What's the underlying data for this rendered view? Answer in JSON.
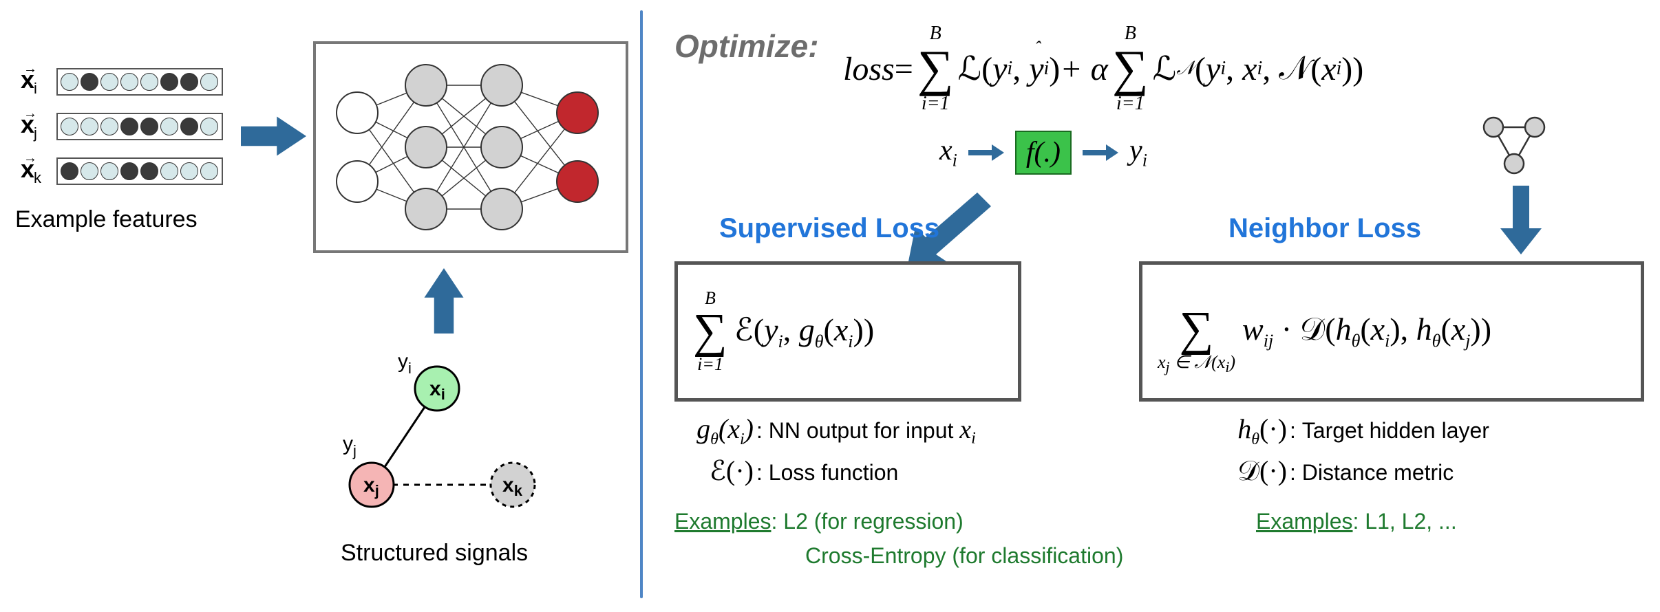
{
  "left": {
    "vectors": {
      "x_i": "x",
      "x_j": "x",
      "x_k": "x",
      "sub_i": "i",
      "sub_j": "j",
      "sub_k": "k"
    },
    "example_features_caption": "Example features",
    "structured_signals_caption": "Structured signals",
    "graph_labels": {
      "yi": "y",
      "yi_sub": "i",
      "xi": "x",
      "xi_sub": "i",
      "yj": "y",
      "yj_sub": "j",
      "xj": "x",
      "xj_sub": "j",
      "xk": "x",
      "xk_sub": "k"
    }
  },
  "right": {
    "optimize": "Optimize:",
    "loss_eq": {
      "loss": "loss",
      "eq": " = ",
      "sum_top": "B",
      "sum_bot": "i=1",
      "L": "ℒ",
      "y": "y",
      "sub_i": "i",
      "yhat": "ŷ",
      "plus_alpha": " + α",
      "Ln_sub": "𝒩",
      "x": "x",
      "N": "𝒩"
    },
    "flow": {
      "xi": "x",
      "sub_i": "i",
      "f": "f(.)",
      "yi": "y"
    },
    "titles": {
      "sup": "Supervised Loss",
      "nei": "Neighbor Loss"
    },
    "sup_box": {
      "sum_top": "B",
      "sum_bot": "i=1",
      "E": "ℰ",
      "y": "y",
      "g": "g",
      "theta": "θ",
      "x": "x",
      "sub_i": "i"
    },
    "nei_box": {
      "sum_bot_pre": "x",
      "sum_bot_sub": "j",
      "sum_bot_in": " ∈ 𝒩(x",
      "sum_bot_sub2": "i",
      "sum_bot_post": ")",
      "w": "w",
      "w_sub": "ij",
      "dot": " · ",
      "D": "𝒟",
      "h": "h",
      "theta": "θ",
      "x": "x",
      "sub_i": "i",
      "sub_j": "j"
    },
    "defs_sup": {
      "g_sym": "g",
      "g_theta": "θ",
      "g_arg_x": "x",
      "g_arg_sub": "i",
      "g_desc_pre": "NN output for input ",
      "g_desc_x": "x",
      "g_desc_sub": "i",
      "E_sym": "ℰ",
      "E_arg": "(·)",
      "E_desc": "Loss function"
    },
    "defs_nei": {
      "h_sym": "h",
      "h_theta": "θ",
      "h_arg": "(·)",
      "h_desc": "Target hidden layer",
      "D_sym": "𝒟",
      "D_arg": "(·)",
      "D_desc": "Distance metric"
    },
    "examples": {
      "sup_label": "Examples",
      "sup_text1": ": L2 (for regression)",
      "sup_text2": "Cross-Entropy (for classification)",
      "nei_label": "Examples",
      "nei_text": ": L1, L2, ..."
    }
  }
}
